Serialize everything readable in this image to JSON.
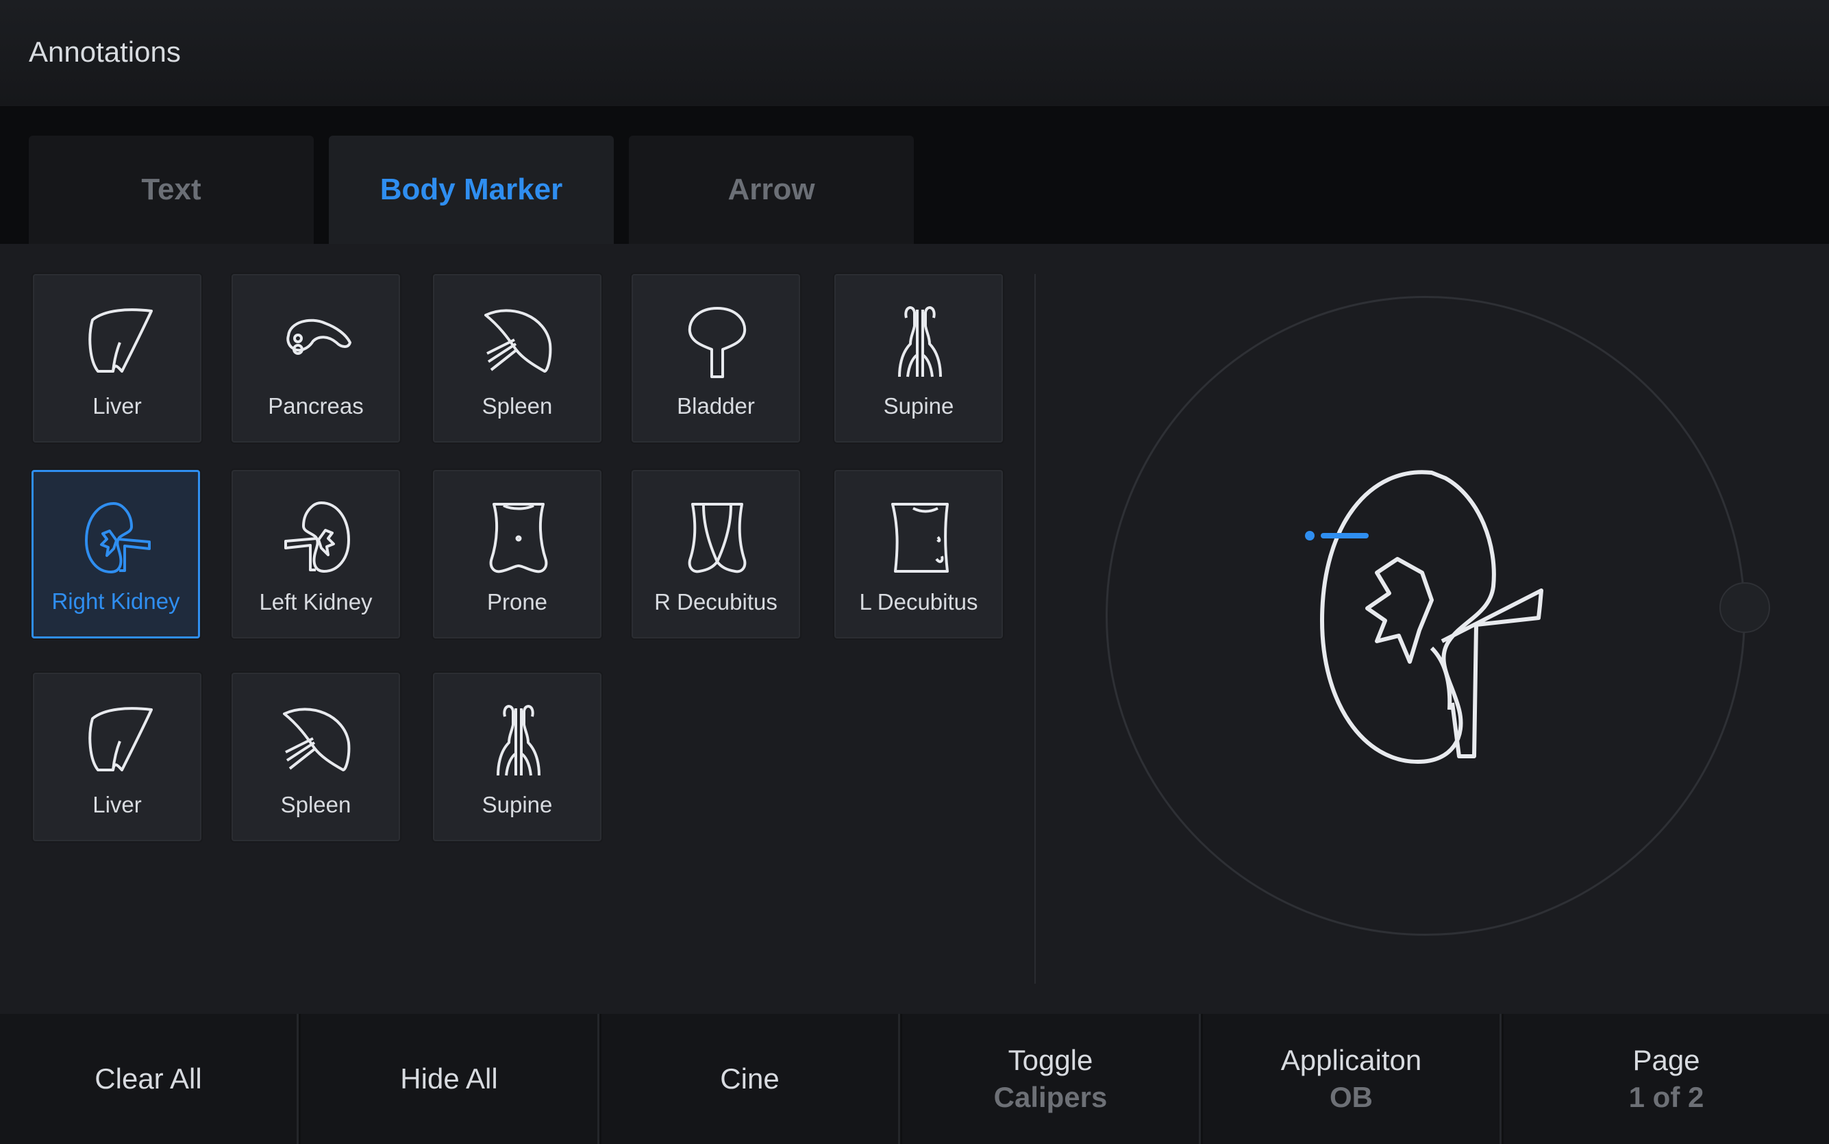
{
  "header": {
    "title": "Annotations"
  },
  "tabs": [
    {
      "label": "Text"
    },
    {
      "label": "Body Marker"
    },
    {
      "label": "Arrow"
    }
  ],
  "tiles": [
    {
      "label": "Liver",
      "icon": "liver-icon"
    },
    {
      "label": "Pancreas",
      "icon": "pancreas-icon"
    },
    {
      "label": "Spleen",
      "icon": "spleen-icon"
    },
    {
      "label": "Bladder",
      "icon": "bladder-icon"
    },
    {
      "label": "Supine",
      "icon": "supine-icon"
    },
    {
      "label": "Right Kidney",
      "icon": "right-kidney-icon",
      "selected": true
    },
    {
      "label": "Left Kidney",
      "icon": "left-kidney-icon"
    },
    {
      "label": "Prone",
      "icon": "prone-icon"
    },
    {
      "label": "R Decubitus",
      "icon": "r-decubitus-icon"
    },
    {
      "label": "L Decubitus",
      "icon": "l-decubitus-icon"
    },
    {
      "label": "Liver",
      "icon": "liver-icon"
    },
    {
      "label": "Spleen",
      "icon": "spleen-icon"
    },
    {
      "label": "Supine",
      "icon": "supine-icon"
    }
  ],
  "preview": {
    "icon": "right-kidney-icon"
  },
  "footer": [
    {
      "label": "Clear All"
    },
    {
      "label": "Hide All"
    },
    {
      "label": "Cine"
    },
    {
      "label": "Toggle",
      "value": "Calipers"
    },
    {
      "label": "Applicaiton",
      "value": "OB"
    },
    {
      "label": "Page",
      "value": "1 of 2"
    }
  ],
  "colors": {
    "accent": "#2f8ef0",
    "background": "#1b1c20",
    "tile": "#23252a"
  }
}
